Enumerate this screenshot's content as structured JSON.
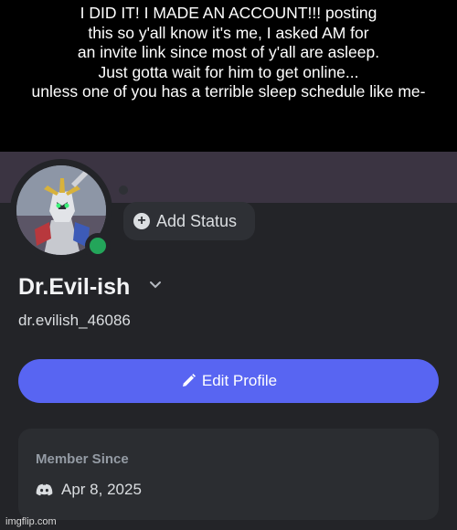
{
  "caption": {
    "lines": [
      "I DID IT! I MADE AN ACCOUNT!!! posting",
      "this so y'all know it's me, I asked AM for",
      "an invite link since most of y'all are asleep.",
      "Just gotta wait for him to get online...",
      "unless one of you has a terrible sleep schedule like me-"
    ]
  },
  "profile": {
    "status_button": {
      "label": "Add Status",
      "icon": "plus-circle-icon"
    },
    "online_status": "online",
    "display_name": "Dr.Evil-ish",
    "username": "dr.evilish_46086",
    "edit_button": {
      "label": "Edit Profile",
      "icon": "pencil-icon"
    },
    "member_since": {
      "title": "Member Since",
      "icon": "discord-logo-icon",
      "date": "Apr 8, 2025"
    }
  },
  "watermark": "imgflip.com",
  "colors": {
    "accent": "#5865f2",
    "online": "#23a55a",
    "panel": "#232428",
    "card": "#2b2d31"
  }
}
